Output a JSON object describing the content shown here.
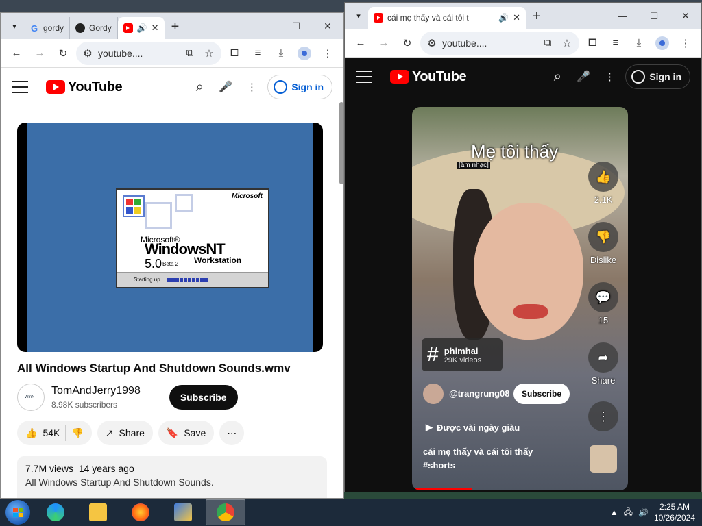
{
  "left_window": {
    "tabs": [
      {
        "title": "gordy",
        "favicon": "google-icon",
        "active": false
      },
      {
        "title": "Gordy",
        "favicon": "gordy-icon",
        "active": false
      },
      {
        "title": "",
        "favicon": "youtube-icon",
        "active": true,
        "audio": true
      }
    ],
    "url": "youtube....",
    "youtube": {
      "logo_text": "YouTube",
      "sign_in": "Sign in",
      "video": {
        "title": "All Windows Startup And Shutdown Sounds.wmv",
        "channel": "TomAndJerry1998",
        "subscribers": "8.98K subscribers",
        "subscribe_label": "Subscribe",
        "likes": "54K",
        "share_label": "Share",
        "save_label": "Save",
        "views": "7.7M views",
        "age": "14 years ago",
        "description": "All Windows Startup And Shutdown Sounds."
      },
      "splash": {
        "brand": "Microsoft",
        "line1": "Microsoft®",
        "line2": "WindowsNT",
        "version": "5.0",
        "beta": "Beta 2",
        "edition": "Workstation",
        "status": "Starting up..."
      }
    }
  },
  "right_window": {
    "tabs": [
      {
        "title": "cái mẹ thấy và cái tôi t",
        "favicon": "youtube-icon",
        "active": true,
        "audio": true
      }
    ],
    "url": "youtube....",
    "youtube": {
      "logo_text": "YouTube",
      "sign_in": "Sign in",
      "short": {
        "overlay_title": "Mẹ tôi thấy",
        "overlay_sub": "[âm nhạc]",
        "likes": "2.1K",
        "dislike_label": "Dislike",
        "comments": "15",
        "share_label": "Share",
        "hashtag": "phimhai",
        "hashtag_videos": "29K videos",
        "channel": "@trangrung08",
        "subscribe_label": "Subscribe",
        "music": "Được vài ngày giàu",
        "caption": "cái mẹ thấy và cái tôi thấy",
        "caption_tag": "#shorts"
      }
    }
  },
  "taskbar": {
    "time": "2:25 AM",
    "date": "10/26/2024"
  },
  "colors": {
    "yt_red": "#ff0000",
    "link_blue": "#065fd4",
    "taskbar": "#1c2a3a"
  }
}
